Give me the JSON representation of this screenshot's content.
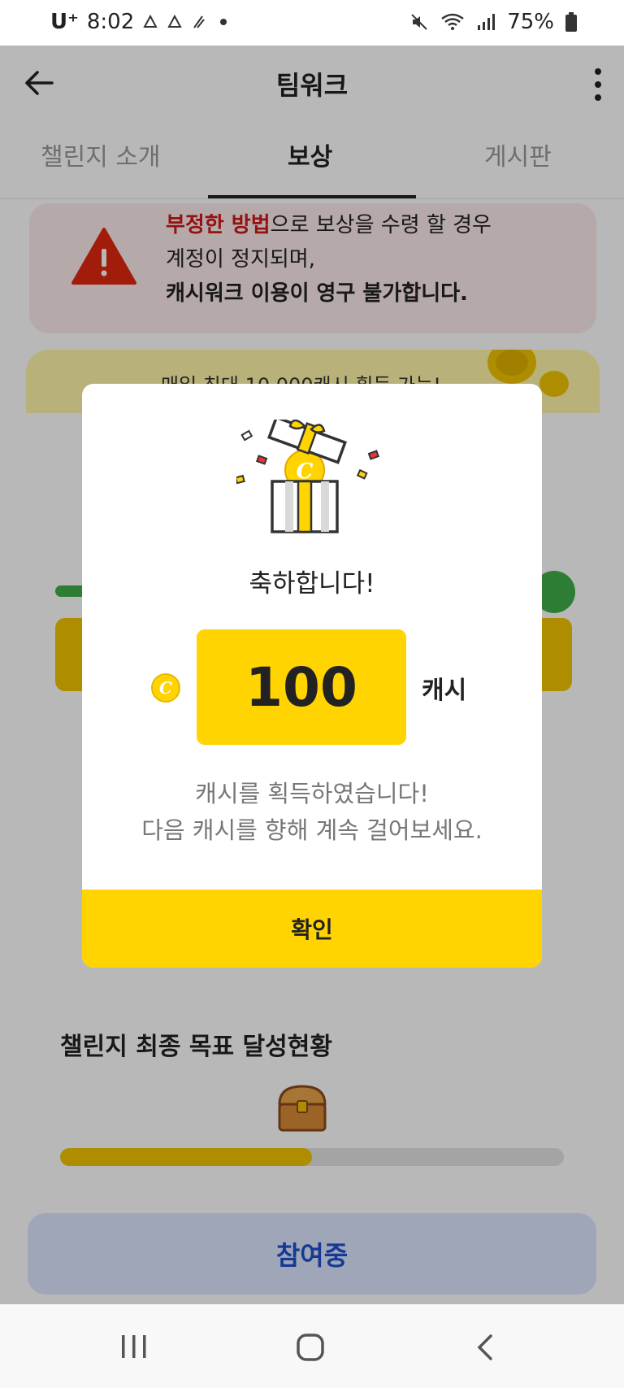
{
  "status_bar": {
    "carrier": "U⁺",
    "time": "8:02",
    "battery": "75%"
  },
  "header": {
    "title": "팀워크"
  },
  "tabs": [
    {
      "label": "챌린지 소개"
    },
    {
      "label": "보상"
    },
    {
      "label": "게시판"
    }
  ],
  "warning": {
    "highlight": "부정한 방법",
    "line1_rest": "으로 보상을 수령 할 경우",
    "line2": "계정이 정지되며,",
    "line3": "캐시워크 이용이 영구 불가합니다."
  },
  "reward_banner": {
    "text": "매일 최대 10,000캐시 획득 가능!"
  },
  "goal": {
    "title": "챌린지 최종 목표 달성현황",
    "progress": 0.5
  },
  "join_button": {
    "label": "참여중"
  },
  "modal": {
    "congrats": "축하합니다!",
    "amount": "100",
    "unit": "캐시",
    "message_line1": "캐시를 획득하였습니다!",
    "message_line2": "다음 캐시를 향해 계속 걸어보세요.",
    "confirm_label": "확인"
  },
  "colors": {
    "accent_yellow": "#ffd400",
    "warning_red": "#d01818",
    "join_blue": "#1f4fcc"
  }
}
